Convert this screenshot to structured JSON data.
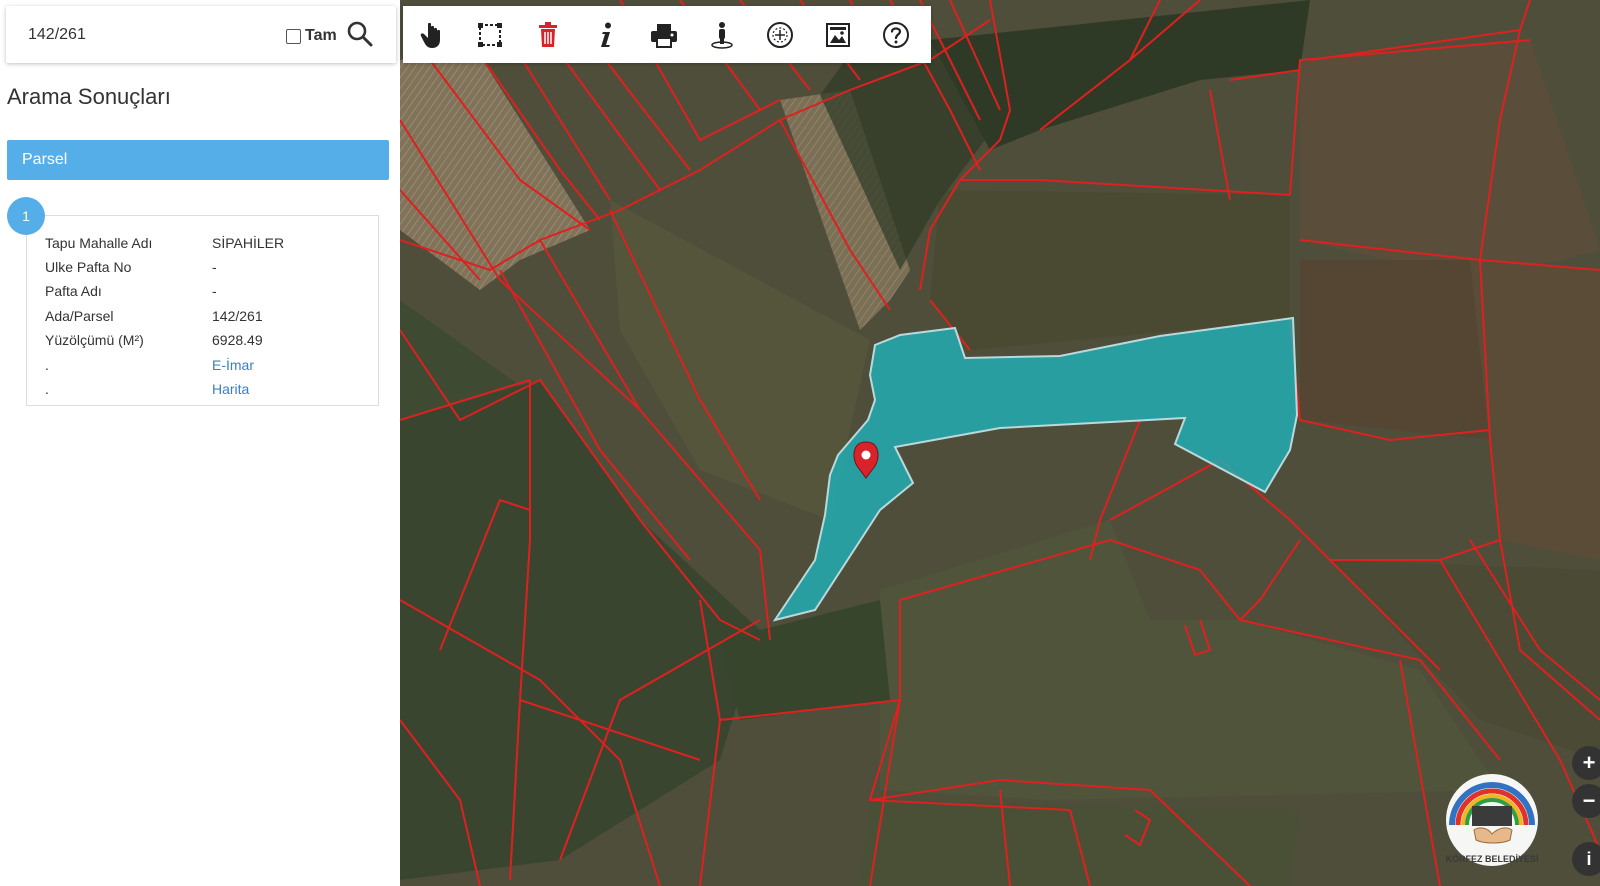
{
  "search": {
    "value": "142/261",
    "tam_label": "Tam"
  },
  "results": {
    "title": "Arama Sonuçları",
    "section": "Parsel",
    "items": [
      {
        "number": "1",
        "fields": [
          {
            "key": "Tapu Mahalle Adı",
            "value": "SİPAHİLER",
            "link": false
          },
          {
            "key": "Ulke Pafta No",
            "value": "-",
            "link": false
          },
          {
            "key": "Pafta Adı",
            "value": "-",
            "link": false
          },
          {
            "key": "Ada/Parsel",
            "value": "142/261",
            "link": false
          },
          {
            "key": "Yüzölçümü (M²)",
            "value": "6928.49",
            "link": false
          },
          {
            "key": ".",
            "value": "E-İmar",
            "link": true
          },
          {
            "key": ".",
            "value": "Harita",
            "link": true
          }
        ]
      }
    ]
  },
  "toolbar": {
    "tools": [
      "hand-pan-icon",
      "select-box-icon",
      "trash-icon",
      "info-icon",
      "print-icon",
      "street-view-icon",
      "measure-icon",
      "image-export-icon",
      "help-icon"
    ]
  },
  "map": {
    "zoom_in": "+",
    "zoom_out": "−",
    "info": "i",
    "logo_text": "KÖRFEZ BELEDİYESİ",
    "colors": {
      "parcel_border": "#e0201f",
      "selected_parcel": "#1fb5bf",
      "marker": "#d9232a",
      "accent": "#56aee8"
    }
  }
}
